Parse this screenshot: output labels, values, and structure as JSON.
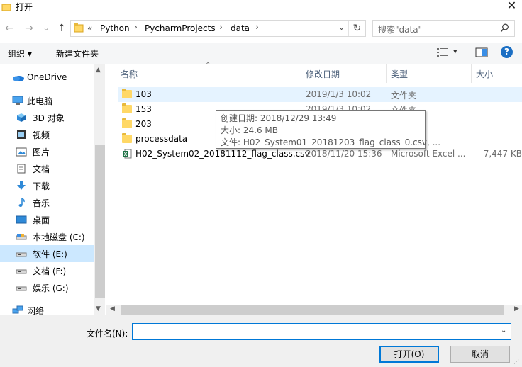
{
  "window": {
    "title": "打开",
    "close": "✕"
  },
  "nav_buttons": {
    "back": "←",
    "forward": "→",
    "recent": "⌄",
    "up": "↑"
  },
  "address": {
    "overflow": "«",
    "crumbs": [
      "Python",
      "PycharmProjects",
      "data"
    ],
    "sep": "›",
    "dropdown": "⌄",
    "refresh": "↻"
  },
  "search": {
    "placeholder": "搜索\"data\"",
    "icon": "search-icon"
  },
  "toolbar": {
    "organize": "组织 ▾",
    "new_folder": "新建文件夹",
    "view_caret": "▾",
    "help": "?"
  },
  "sidebar": {
    "items": [
      {
        "label": "OneDrive",
        "icon": "onedrive-icon"
      },
      {
        "label": "此电脑",
        "icon": "computer-icon"
      },
      {
        "label": "3D 对象",
        "icon": "3d-objects-icon"
      },
      {
        "label": "视频",
        "icon": "video-icon"
      },
      {
        "label": "图片",
        "icon": "pictures-icon"
      },
      {
        "label": "文档",
        "icon": "documents-icon"
      },
      {
        "label": "下载",
        "icon": "download-icon"
      },
      {
        "label": "音乐",
        "icon": "music-icon"
      },
      {
        "label": "桌面",
        "icon": "desktop-icon"
      },
      {
        "label": "本地磁盘 (C:)",
        "icon": "drive-icon"
      },
      {
        "label": "软件 (E:)",
        "icon": "drive-icon",
        "selected": true
      },
      {
        "label": "文档 (F:)",
        "icon": "drive-icon"
      },
      {
        "label": "娱乐 (G:)",
        "icon": "drive-icon"
      },
      {
        "label": "网络",
        "icon": "network-icon"
      }
    ]
  },
  "columns": {
    "name": "名称",
    "modified": "修改日期",
    "type": "类型",
    "size": "大小"
  },
  "files": [
    {
      "name": "103",
      "modified": "2019/1/3 10:02",
      "type": "文件夹",
      "size": "",
      "icon": "folder-icon"
    },
    {
      "name": "153",
      "modified": "2019/1/3 10:02",
      "type": "文件夹",
      "size": "",
      "icon": "folder-icon"
    },
    {
      "name": "203",
      "modified": "",
      "type": "",
      "size": "",
      "icon": "folder-icon"
    },
    {
      "name": "processdata",
      "modified": "",
      "type": "",
      "size": "",
      "icon": "folder-icon"
    },
    {
      "name": "H02_System02_20181112_flag_class.csv",
      "modified": "2018/11/20 15:36",
      "type": "Microsoft Excel ...",
      "size": "7,447 KB",
      "icon": "excel-csv-icon"
    }
  ],
  "tooltip": {
    "created": "创建日期: 2018/12/29 13:49",
    "size": "大小: 24.6 MB",
    "files": "文件: H02_System01_20181203_flag_class_0.csv, ..."
  },
  "footer": {
    "filename_label": "文件名(N):",
    "filename_value": "",
    "open": "打开(O)",
    "cancel": "取消"
  },
  "colors": {
    "accent": "#0078d7",
    "selection": "#cce8ff",
    "hover": "#e5f3ff",
    "folder": "#ffd866"
  }
}
